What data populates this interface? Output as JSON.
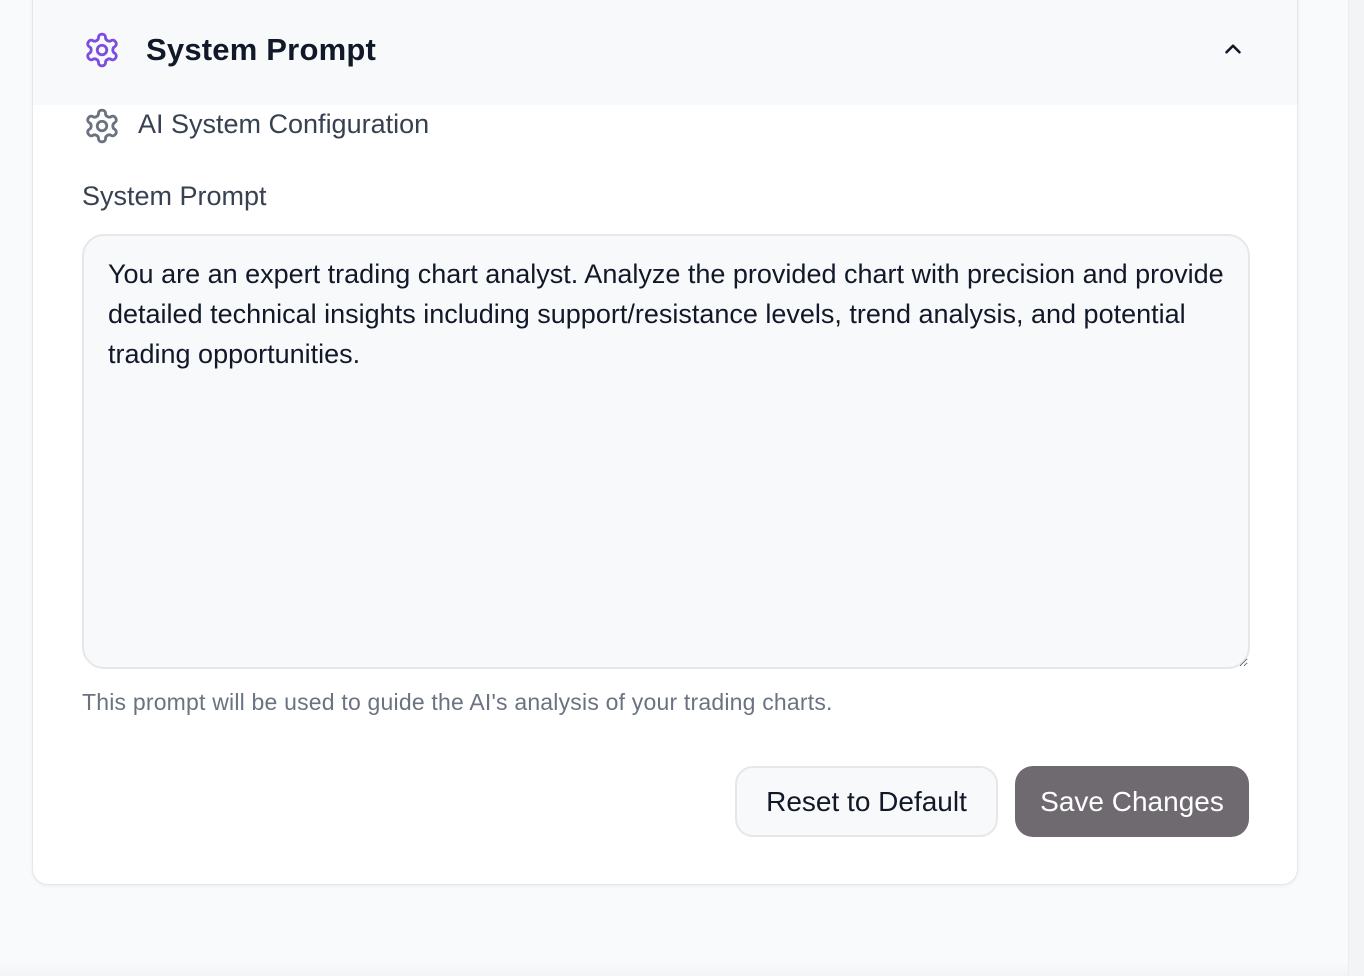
{
  "section": {
    "title": "System Prompt",
    "header_icon": "gear-icon",
    "collapse_icon": "chevron-up-icon",
    "accent_color": "#7c4dde"
  },
  "config": {
    "subtitle": "AI System Configuration",
    "subtitle_icon": "gear-icon"
  },
  "prompt_field": {
    "label": "System Prompt",
    "value": "You are an expert trading chart analyst. Analyze the provided chart with precision and provide detailed technical insights including support/resistance levels, trend analysis, and potential trading opportunities.",
    "helper": "This prompt will be used to guide the AI's analysis of your trading charts."
  },
  "actions": {
    "reset_label": "Reset to Default",
    "save_label": "Save Changes",
    "save_color": "#6f6a70"
  }
}
